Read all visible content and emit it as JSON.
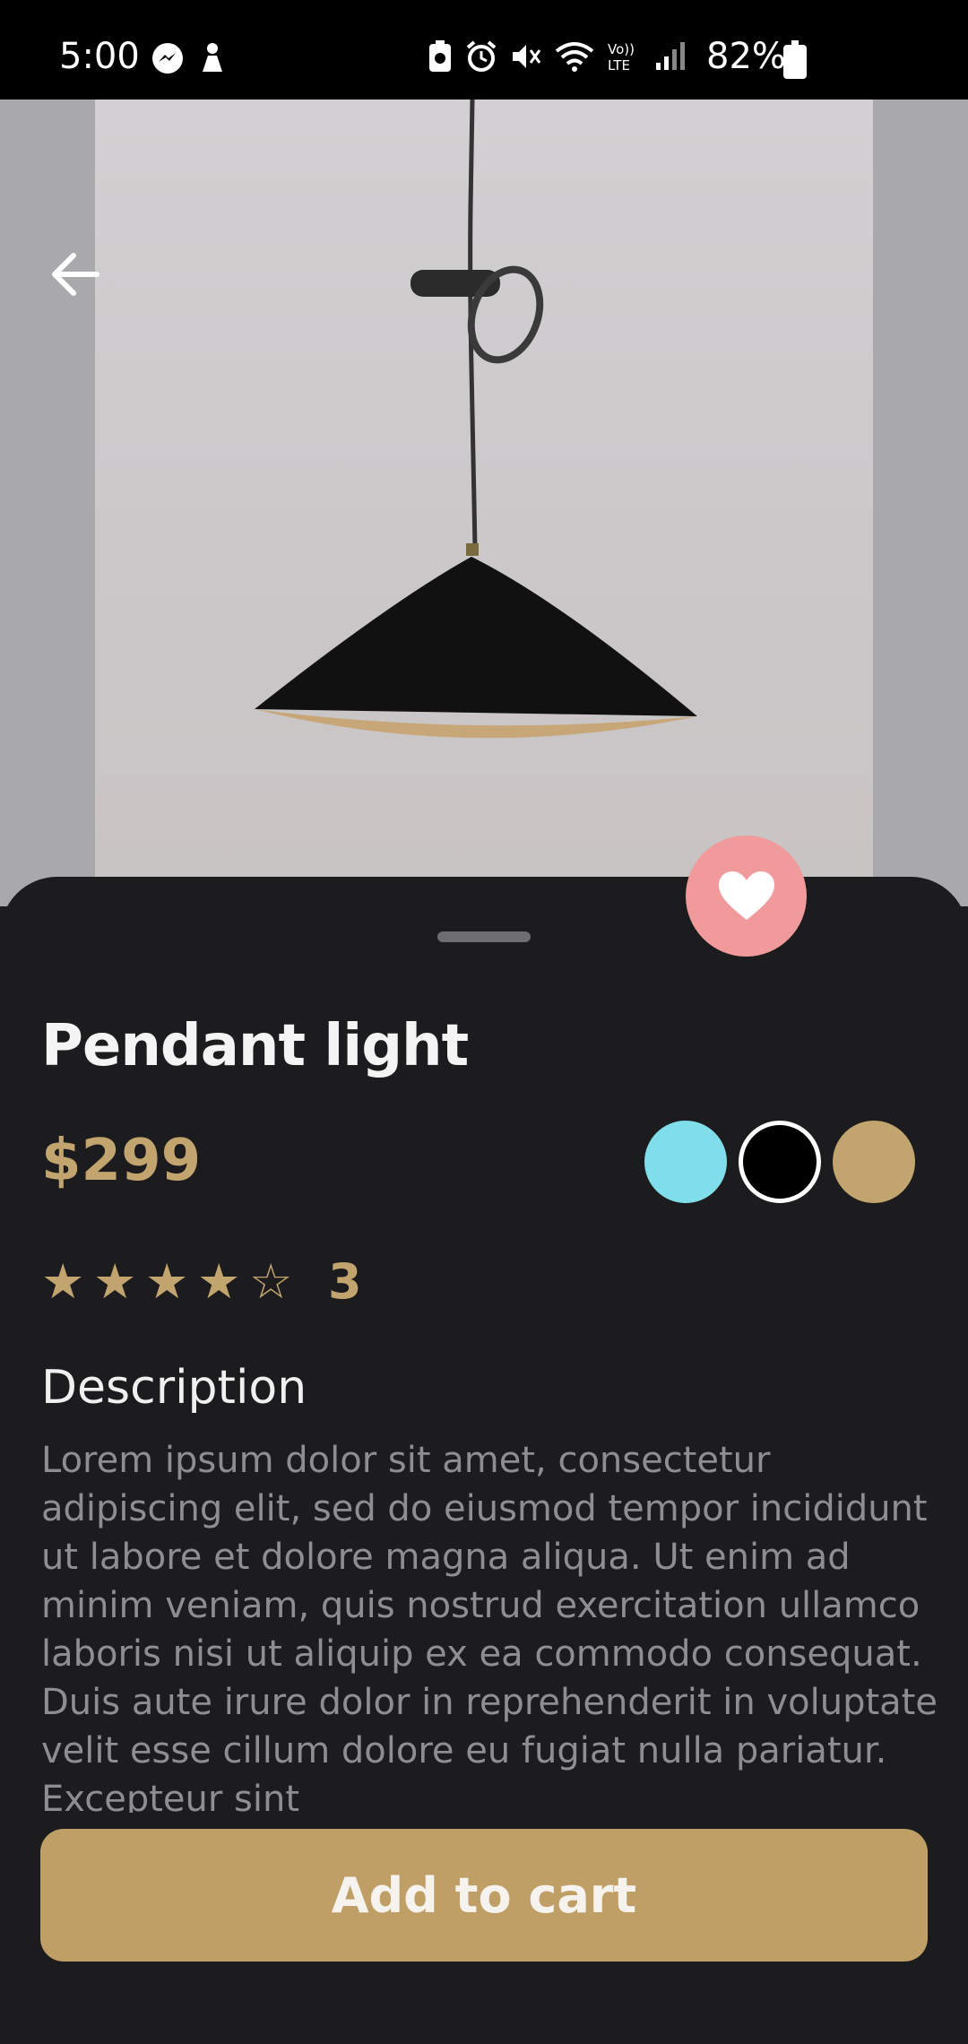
{
  "status_bar": {
    "time": "5:00",
    "battery": "82%",
    "left_icons": [
      "messenger-icon",
      "person-icon"
    ],
    "right_icons": [
      "battery-saver-icon",
      "alarm-icon",
      "mute-icon",
      "wifi-icon",
      "volte-icon",
      "signal-icon",
      "battery-icon"
    ]
  },
  "product": {
    "name": "Pendant light",
    "price": "$299",
    "rating_count": "3",
    "rating_value": 4,
    "rating_max": 5,
    "colors": [
      "#7fdeea",
      "#000000",
      "#c2a46e"
    ],
    "selected_color_index": 1
  },
  "description": {
    "heading": "Description",
    "body": "Lorem ipsum dolor sit amet, consectetur adipiscing elit, sed do eiusmod tempor incididunt ut labore et dolore magna aliqua. Ut enim ad minim veniam, quis nostrud exercitation ullamco laboris nisi ut aliquip ex ea commodo consequat. Duis aute irure dolor in reprehenderit in voluptate velit esse cillum dolore eu fugiat nulla pariatur. Excepteur sint"
  },
  "actions": {
    "add_to_cart": "Add to cart"
  },
  "theme": {
    "accent": "#c2a46e",
    "button": "#bf9f66",
    "favorite": "#f09a9c",
    "sheet_bg": "#1c1c1e"
  }
}
